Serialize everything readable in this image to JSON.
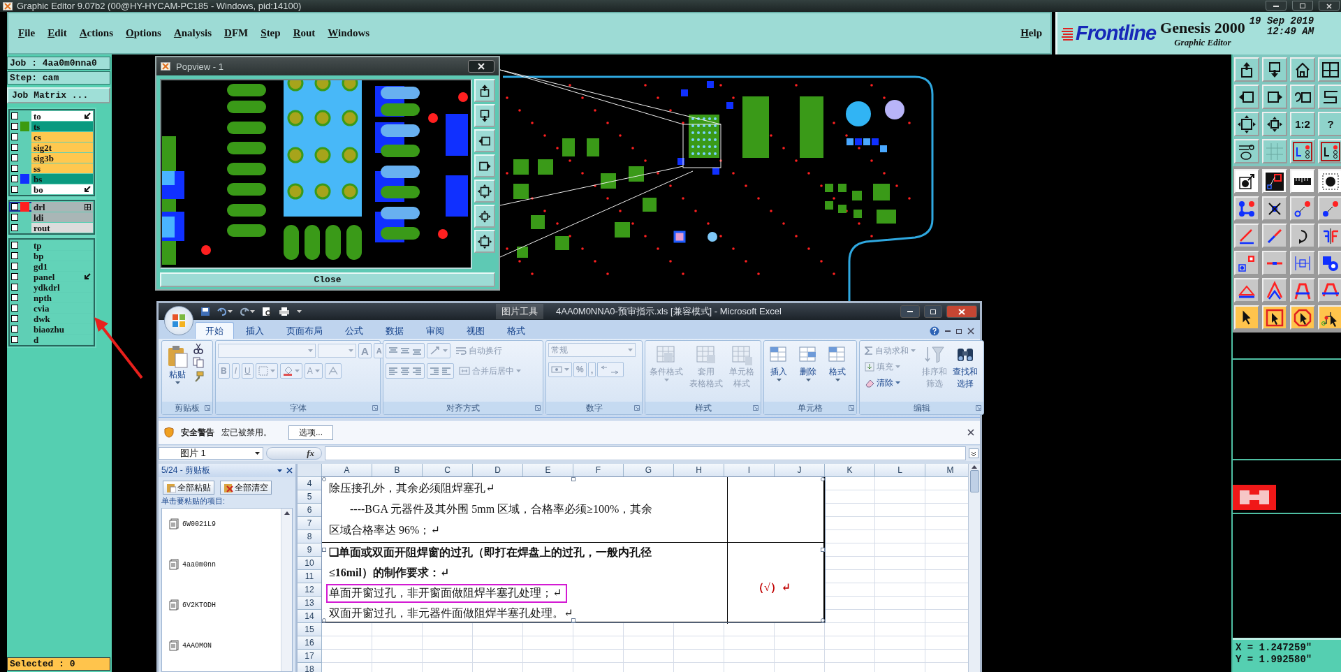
{
  "window": {
    "title": "Graphic Editor 9.07b2 (00@HY-HYCAM-PC185 - Windows, pid:14100)"
  },
  "menu": {
    "items": [
      "File",
      "Edit",
      "Actions",
      "Options",
      "Analysis",
      "DFM",
      "Step",
      "Rout",
      "Windows"
    ],
    "help": "Help"
  },
  "brand": {
    "logo": "Frontline",
    "product": "Genesis 2000",
    "subtitle": "Graphic Editor",
    "date": "19 Sep 2019",
    "time": "12:49 AM"
  },
  "left_panel": {
    "job": "Job : 4aa0m0nna0",
    "step": "Step: cam",
    "matrix_button": "Job Matrix ...",
    "layer_groups": [
      {
        "layers": [
          {
            "name": "to",
            "kind": "edit",
            "checked": false,
            "selected": false,
            "color": "#ffffff"
          },
          {
            "name": "ts",
            "kind": "plain",
            "checked": false,
            "selected": false,
            "color": "#0a9a80",
            "swatch": {
              "color": "#3c9a10"
            }
          },
          {
            "name": "cs",
            "kind": "plain",
            "checked": false,
            "selected": false,
            "color": "#ffc84f"
          },
          {
            "name": "sig2t",
            "kind": "plain",
            "checked": false,
            "selected": false,
            "color": "#ffc84f"
          },
          {
            "name": "sig3b",
            "kind": "plain",
            "checked": false,
            "selected": false,
            "color": "#ffc84f"
          },
          {
            "name": "ss",
            "kind": "plain",
            "checked": false,
            "selected": false,
            "color": "#ffc84f"
          },
          {
            "name": "bs",
            "kind": "plain",
            "checked": false,
            "selected": false,
            "color": "#0a9a80",
            "swatch": {
              "color": "#1030ff"
            }
          },
          {
            "name": "bo",
            "kind": "edit",
            "checked": false,
            "selected": false,
            "color": "#ffffff"
          }
        ]
      },
      {
        "layers": [
          {
            "name": "drl",
            "kind": "grid",
            "checked": false,
            "selected": true,
            "color": "#a9b6b6",
            "swatch": {
              "color": "#ff2020"
            }
          },
          {
            "name": "ldi",
            "kind": "plain",
            "checked": false,
            "selected": false,
            "color": "#a9b6b6"
          },
          {
            "name": "rout",
            "kind": "plain",
            "checked": false,
            "selected": false,
            "color": "#dcdcdc"
          }
        ]
      },
      {
        "layers": [
          {
            "name": "tp",
            "kind": "plain",
            "checked": false,
            "selected": false,
            "color": "#62d3b8"
          },
          {
            "name": "bp",
            "kind": "plain",
            "checked": false,
            "selected": false,
            "color": "#62d3b8"
          },
          {
            "name": "gd1",
            "kind": "plain",
            "checked": false,
            "selected": false,
            "color": "#62d3b8"
          },
          {
            "name": "panel",
            "kind": "edit",
            "checked": false,
            "selected": false,
            "color": "#62d3b8"
          },
          {
            "name": "ydkdrl",
            "kind": "plain",
            "checked": false,
            "selected": false,
            "color": "#62d3b8"
          },
          {
            "name": "npth",
            "kind": "plain",
            "checked": false,
            "selected": false,
            "color": "#62d3b8"
          },
          {
            "name": "cvia",
            "kind": "plain",
            "checked": false,
            "selected": false,
            "color": "#62d3b8"
          },
          {
            "name": "dwk",
            "kind": "plain",
            "checked": false,
            "selected": false,
            "color": "#62d3b8"
          },
          {
            "name": "biaozhu",
            "kind": "plain",
            "checked": false,
            "selected": false,
            "color": "#62d3b8"
          },
          {
            "name": "d",
            "kind": "plain",
            "checked": false,
            "selected": false,
            "color": "#62d3b8"
          }
        ]
      }
    ],
    "status": "Selected : 0"
  },
  "popview": {
    "title": "Popview - 1",
    "close_button": "Close"
  },
  "toolbar": {
    "labels": [
      "1:2",
      "?"
    ]
  },
  "coordinates": [
    "X = 1.247259\"",
    "Y = 1.992580\""
  ],
  "excel": {
    "context_tab": "图片工具",
    "title": "4AA0M0NNA0-预审指示.xls  [兼容模式] - Microsoft Excel",
    "tabs": [
      {
        "label": "开始",
        "selected": true
      },
      {
        "label": "插入",
        "selected": false
      },
      {
        "label": "页面布局",
        "selected": false
      },
      {
        "label": "公式",
        "selected": false
      },
      {
        "label": "数据",
        "selected": false
      },
      {
        "label": "审阅",
        "selected": false
      },
      {
        "label": "视图",
        "selected": false
      },
      {
        "label": "格式",
        "selected": false
      }
    ],
    "ribbon": {
      "clipboard": {
        "label": "剪贴板",
        "paste": "粘贴",
        "disabled": false
      },
      "font": {
        "label": "字体",
        "buttons": [
          "B",
          "I",
          "U"
        ],
        "grow": "A",
        "shrink": "A",
        "font_color_button": "A",
        "disabled": true
      },
      "alignment": {
        "label": "对齐方式",
        "wrap": "自动换行",
        "merge": "合并后居中",
        "disabled": true
      },
      "number": {
        "label": "数字",
        "format": "常规",
        "percent": "%",
        "comma": ",",
        "disabled": true
      },
      "styles": {
        "label": "样式",
        "items": [
          {
            "lines": [
              "条件格式"
            ]
          },
          {
            "lines": [
              "套用",
              "表格格式"
            ]
          },
          {
            "lines": [
              "单元格",
              "样式"
            ]
          }
        ],
        "disabled": true
      },
      "cells": {
        "label": "单元格",
        "items": [
          "插入",
          "删除",
          "格式"
        ],
        "disabled": false
      },
      "editing": {
        "label": "编辑",
        "small": [
          {
            "label": "自动求和",
            "disabled": true
          },
          {
            "label": "填充",
            "disabled": true
          },
          {
            "label": "清除",
            "disabled": false
          }
        ],
        "large": [
          {
            "lines": [
              "排序和",
              "筛选"
            ],
            "disabled": true
          },
          {
            "lines": [
              "查找和",
              "选择"
            ],
            "disabled": false
          }
        ]
      }
    },
    "security": {
      "title": "安全警告",
      "message": "宏已被禁用。",
      "button": "选项..."
    },
    "formula_bar": {
      "name_box": "图片 1",
      "fx": "fx"
    },
    "clipboard_pane": {
      "title": "5/24 - 剪贴板",
      "paste_all": "全部粘贴",
      "clear_all": "全部清空",
      "hint": "单击要粘贴的项目:",
      "items": [
        "6W0021L9",
        "4aa0m0nn",
        "6V2KTODH",
        "4AAOMON"
      ]
    },
    "sheet": {
      "columns": [
        "A",
        "B",
        "C",
        "D",
        "E",
        "F",
        "G",
        "H",
        "I",
        "J",
        "K",
        "L",
        "M"
      ],
      "rows": [
        "4",
        "5",
        "6",
        "7",
        "8",
        "9",
        "10",
        "11",
        "12",
        "13",
        "14",
        "15",
        "16",
        "17",
        "18"
      ],
      "picture": {
        "selected": true,
        "sections": [
          {
            "lines": [
              {
                "text": "除压接孔外，其余必须阻焊塞孔↵",
                "bold": false,
                "indent": false,
                "highlight": false
              },
              {
                "text": "----BGA 元器件及其外围 5mm 区域，合格率必须≥100%，其余",
                "bold": false,
                "indent": true,
                "highlight": false
              },
              {
                "text": "区域合格率达 96%；↵",
                "bold": false,
                "indent": false,
                "highlight": false
              }
            ]
          },
          {
            "lines": [
              {
                "text": "❑单面或双面开阻焊窗的过孔（即打在焊盘上的过孔，一般内孔径",
                "bold": true,
                "indent": false,
                "highlight": false
              },
              {
                "text": "≤16mil）的制作要求：↵",
                "bold": true,
                "indent": false,
                "highlight": false
              },
              {
                "text": "单面开窗过孔，非开窗面做阻焊半塞孔处理；↵",
                "bold": false,
                "indent": false,
                "highlight": true
              },
              {
                "text": "双面开窗过孔，非元器件面做阻焊半塞孔处理。↵",
                "bold": false,
                "indent": false,
                "highlight": false
              }
            ],
            "mark": "（√）↵"
          }
        ]
      }
    }
  }
}
